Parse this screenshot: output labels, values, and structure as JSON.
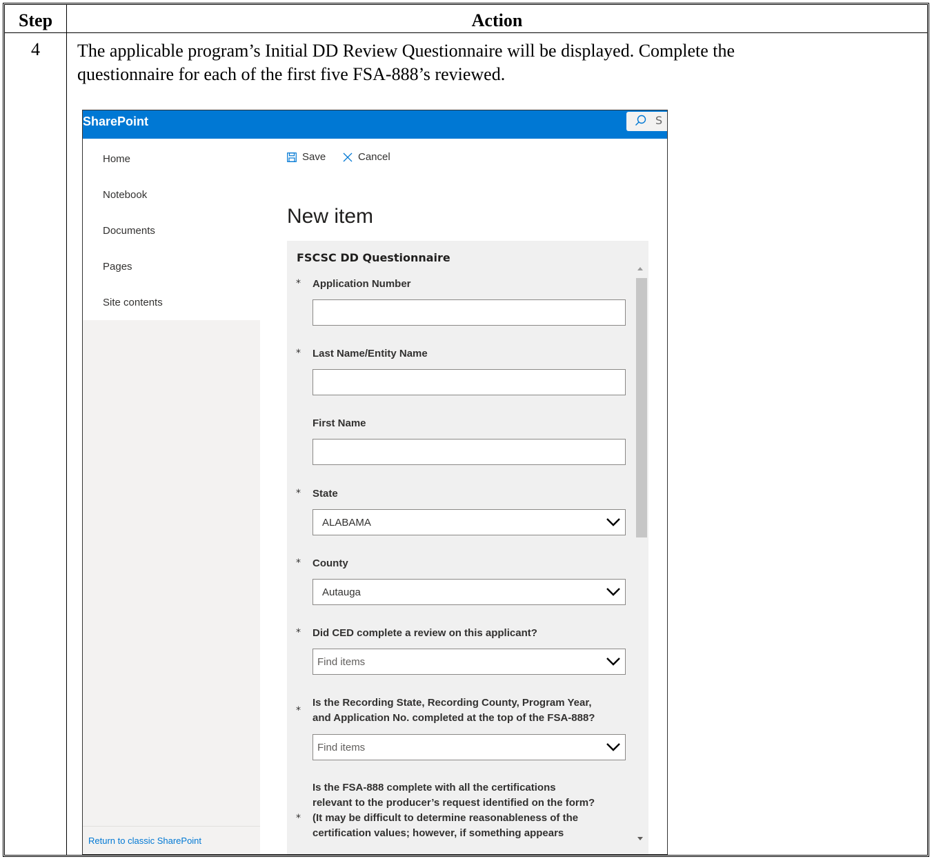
{
  "document": {
    "header_step": "Step",
    "header_action": "Action",
    "step_number": "4",
    "action_line1": "The applicable program’s Initial DD Review Questionnaire will be displayed.  Complete the",
    "action_line2": "questionnaire for each of the first five FSA-888’s reviewed."
  },
  "sharepoint": {
    "brand": "SharePoint",
    "search_partial": "S",
    "accent_color": "#0078d4",
    "nav": {
      "items": [
        {
          "label": "Home"
        },
        {
          "label": "Notebook"
        },
        {
          "label": "Documents"
        },
        {
          "label": "Pages"
        },
        {
          "label": "Site contents"
        }
      ],
      "classic_link": "Return to classic SharePoint"
    },
    "commands": {
      "save_label": "Save",
      "cancel_label": "Cancel"
    },
    "page_title": "New item",
    "form": {
      "title": "FSCSC DD Questionnaire",
      "required_mark": "*",
      "fields": {
        "application_number": {
          "label": "Application Number",
          "value": ""
        },
        "last_name": {
          "label": "Last Name/Entity Name",
          "value": ""
        },
        "first_name": {
          "label": "First Name",
          "value": ""
        },
        "state": {
          "label": "State",
          "value": "ALABAMA"
        },
        "county": {
          "label": "County",
          "value": "Autauga"
        },
        "ced_review": {
          "label": "Did CED complete a review on this applicant?",
          "placeholder": "Find items"
        },
        "recording_state": {
          "label_line1": "Is the Recording State, Recording County, Program Year,",
          "label_line2": "and Application No. completed at the top of the FSA-888?",
          "placeholder": "Find items"
        },
        "fsa888_complete": {
          "label_line1": "Is the FSA-888 complete with all the certifications",
          "label_line2": "relevant to the producer’s request identified on the form?",
          "label_line3": "(It may be difficult to determine reasonableness of the",
          "label_line4": "certification values; however, if something appears"
        }
      }
    }
  }
}
